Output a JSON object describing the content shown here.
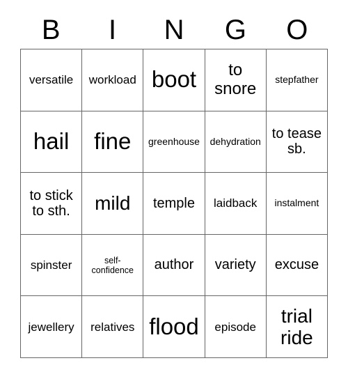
{
  "card": {
    "title_letters": [
      "B",
      "I",
      "N",
      "G",
      "O"
    ],
    "columns": 5,
    "rows": 5,
    "grid_border_color": "#666666",
    "text_color": "#000000",
    "background_color": "#ffffff",
    "cells": [
      {
        "text": "versatile",
        "size": "s"
      },
      {
        "text": "workload",
        "size": "s"
      },
      {
        "text": "boot",
        "size": "xxl"
      },
      {
        "text": "to snore",
        "size": "l"
      },
      {
        "text": "stepfather",
        "size": "xs"
      },
      {
        "text": "hail",
        "size": "xxl"
      },
      {
        "text": "fine",
        "size": "xxl"
      },
      {
        "text": "greenhouse",
        "size": "xs"
      },
      {
        "text": "dehydration",
        "size": "xs"
      },
      {
        "text": "to tease sb.",
        "size": "m"
      },
      {
        "text": "to stick to sth.",
        "size": "m"
      },
      {
        "text": "mild",
        "size": "xl"
      },
      {
        "text": "temple",
        "size": "m"
      },
      {
        "text": "laidback",
        "size": "s"
      },
      {
        "text": "instalment",
        "size": "xs"
      },
      {
        "text": "spinster",
        "size": "s"
      },
      {
        "text": "self-confidence",
        "size": "xxs"
      },
      {
        "text": "author",
        "size": "m"
      },
      {
        "text": "variety",
        "size": "m"
      },
      {
        "text": "excuse",
        "size": "m"
      },
      {
        "text": "jewellery",
        "size": "s"
      },
      {
        "text": "relatives",
        "size": "s"
      },
      {
        "text": "flood",
        "size": "xxl"
      },
      {
        "text": "episode",
        "size": "s"
      },
      {
        "text": "trial ride",
        "size": "xl"
      }
    ]
  }
}
